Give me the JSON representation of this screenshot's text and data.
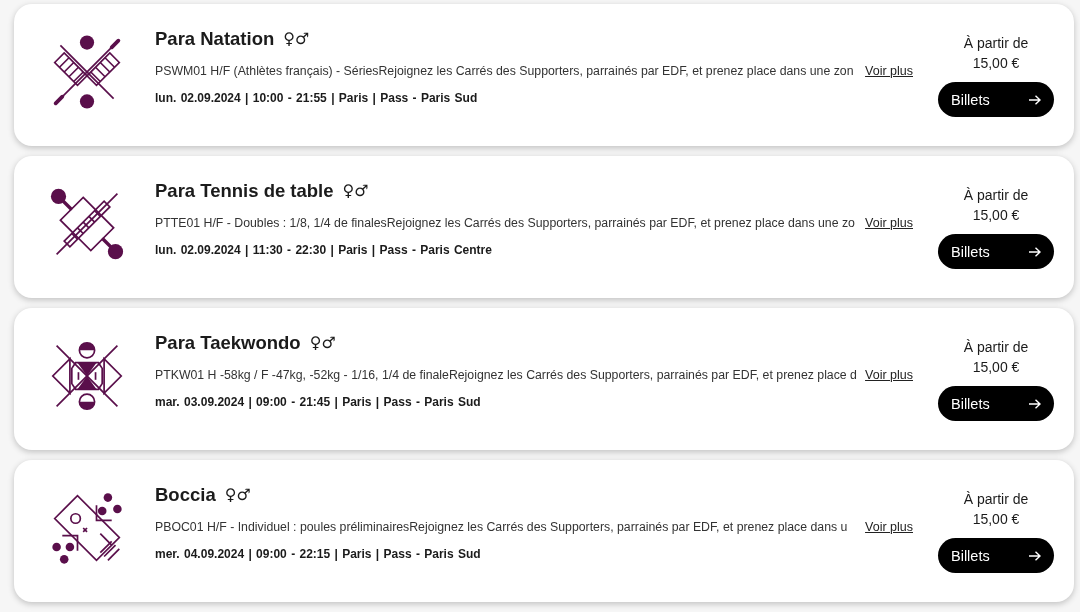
{
  "events": [
    {
      "kind": "swimming",
      "sport": "Para Natation",
      "gender": "♀♂",
      "description": "PSWM01 H/F (Athlètes français) - SériesRejoignez les Carrés des Supporters, parrainés par EDF, et prenez place dans une zon",
      "more_link": "Voir plus",
      "details": "lun. 02.09.2024 | 10:00 - 21:55 | Paris | Pass - Paris Sud",
      "price_label": "À partir de",
      "price": "15,00 €",
      "button": "Billets"
    },
    {
      "kind": "table_tennis",
      "sport": "Para Tennis de table",
      "gender": "♀♂",
      "description": "PTTE01 H/F - Doubles : 1/8, 1/4 de finalesRejoignez les Carrés des Supporters, parrainés par EDF, et prenez place dans une zo",
      "more_link": "Voir plus",
      "details": "lun. 02.09.2024 | 11:30 - 22:30 | Paris | Pass - Paris Centre",
      "price_label": "À partir de",
      "price": "15,00 €",
      "button": "Billets"
    },
    {
      "kind": "taekwondo",
      "sport": "Para Taekwondo",
      "gender": "♀♂",
      "description": "PTKW01 H -58kg / F -47kg, -52kg - 1/16, 1/4 de finaleRejoignez les Carrés des Supporters, parrainés par EDF, et prenez place d",
      "more_link": "Voir plus",
      "details": "mar. 03.09.2024 | 09:00 - 21:45 | Paris | Pass - Paris Sud",
      "price_label": "À partir de",
      "price": "15,00 €",
      "button": "Billets"
    },
    {
      "kind": "boccia",
      "sport": "Boccia",
      "gender": "♀♂",
      "description": "PBOC01 H/F - Individuel : poules préliminairesRejoignez les Carrés des Supporters, parrainés par EDF, et prenez place dans u",
      "more_link": "Voir plus",
      "details": "mer. 04.09.2024 | 09:00 - 22:15 | Paris | Pass - Paris Sud",
      "price_label": "À partir de",
      "price": "15,00 €",
      "button": "Billets"
    }
  ]
}
